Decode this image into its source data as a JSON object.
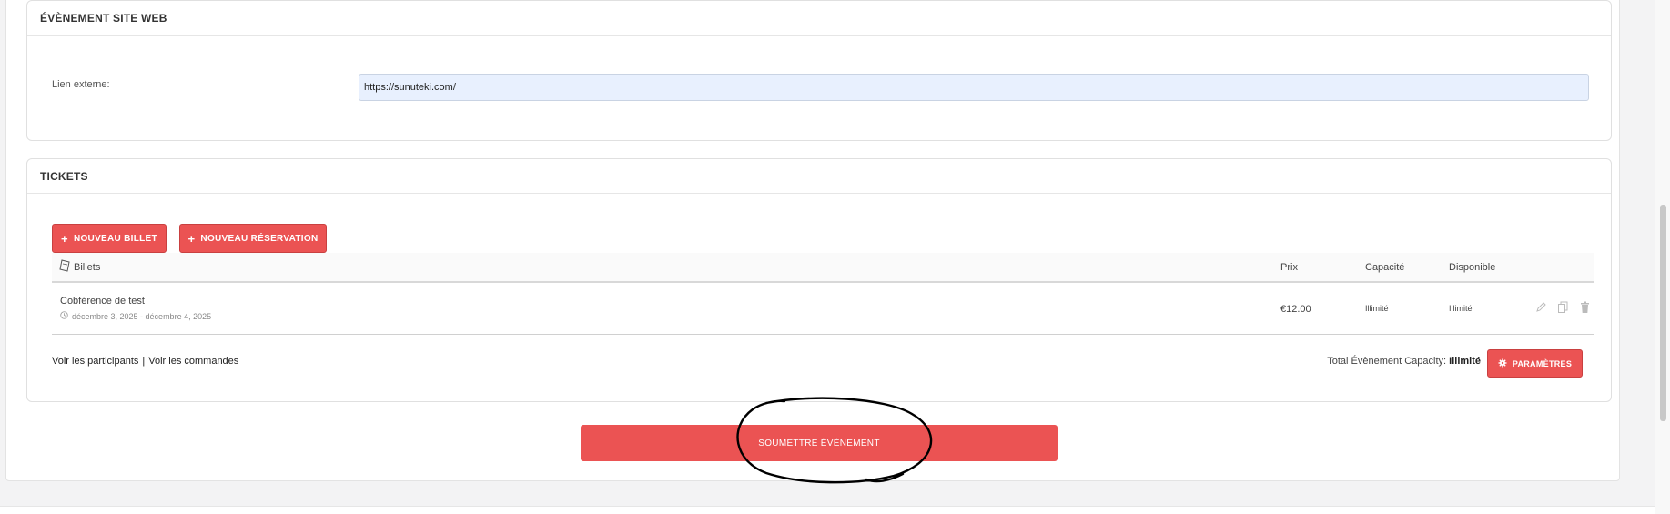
{
  "web_section": {
    "title": "ÉVÈNEMENT SITE WEB",
    "external_link_label": "Lien externe:",
    "external_link_value": "https://sunuteki.com/"
  },
  "tickets_section": {
    "title": "TICKETS",
    "new_ticket_button": "NOUVEAU BILLET",
    "new_reservation_button": "NOUVEAU RÉSERVATION",
    "columns": {
      "billets": "Billets",
      "prix": "Prix",
      "capacite": "Capacité",
      "disponible": "Disponible"
    },
    "rows": [
      {
        "name": "Cobférence de test",
        "dates": "décembre 3, 2025 - décembre 4, 2025",
        "prix": "€12.00",
        "capacite": "Illimité",
        "disponible": "Illimité"
      }
    ],
    "links": {
      "participants": "Voir les participants",
      "separator": "|",
      "commandes": "Voir les commandes"
    },
    "total_capacity_label": "Total Évènement Capacity:",
    "total_capacity_value": "Illimité",
    "params_button": "PARAMÈTRES"
  },
  "submit_button": "SOUMETTRE ÉVÈNEMENT",
  "colors": {
    "accent": "#eb5353",
    "input_bg": "#e8f0fe"
  },
  "icons": [
    "plus-icon",
    "ticket-icon",
    "clock-icon",
    "edit-icon",
    "copy-icon",
    "trash-icon",
    "gear-icon"
  ]
}
